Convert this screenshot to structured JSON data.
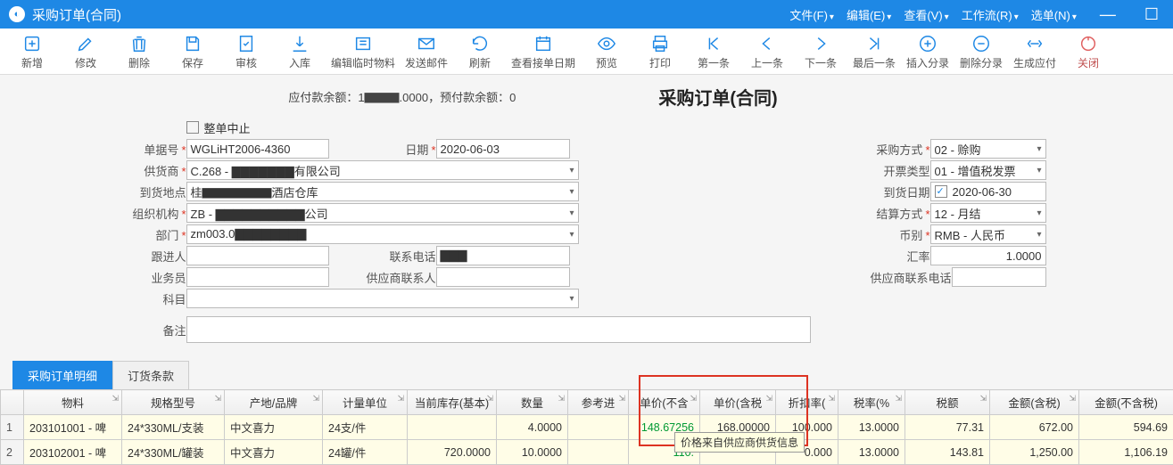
{
  "window": {
    "title": "采购订单(合同)"
  },
  "menus": [
    "文件(F)",
    "编辑(E)",
    "查看(V)",
    "工作流(R)",
    "选单(N)"
  ],
  "toolbar": [
    "新增",
    "修改",
    "删除",
    "保存",
    "审核",
    "入库",
    "编辑临时物料",
    "发送邮件",
    "刷新",
    "查看接单日期",
    "预览",
    "打印",
    "第一条",
    "上一条",
    "下一条",
    "最后一条",
    "插入分录",
    "删除分录",
    "生成应付",
    "关闭"
  ],
  "balances": "应付款余额：1▇▇▇.0000，预付款余额：0",
  "page_title": "采购订单(合同)",
  "form": {
    "suspend": "整单中止",
    "doc_no_lbl": "单据号",
    "doc_no": "WGLiHT2006-4360",
    "date_lbl": "日期",
    "date": "2020-06-03",
    "purch_mode_lbl": "采购方式",
    "purch_mode": "02 - 赊购",
    "vendor_lbl": "供货商",
    "vendor": "C.268 - ▇▇▇▇▇▇▇有限公司",
    "inv_type_lbl": "开票类型",
    "inv_type": "01 - 增值税发票",
    "recv_loc_lbl": "到货地点",
    "recv_loc": "桂▇▇▇▇▇▇酒店仓库",
    "recv_date_lbl": "到货日期",
    "recv_date": "2020-06-30",
    "org_lbl": "组织机构",
    "org": "ZB - ▇▇▇▇▇▇▇▇▇▇公司",
    "settle_lbl": "结算方式",
    "settle": "12 - 月结",
    "dept_lbl": "部门",
    "dept": "zm003.0▇▇▇▇▇▇▇▇",
    "curr_lbl": "币别",
    "curr": "RMB - 人民币",
    "follower_lbl": "跟进人",
    "follower": "",
    "phone_lbl": "联系电话",
    "phone": "▇▇▇",
    "rate_lbl": "汇率",
    "rate": "1.0000",
    "sales_lbl": "业务员",
    "sales": "",
    "v_contact_lbl": "供应商联系人",
    "v_contact": "",
    "v_phone_lbl": "供应商联系电话",
    "v_phone": "",
    "subject_lbl": "科目",
    "subject": "",
    "remark_lbl": "备注",
    "remark": ""
  },
  "tabs": [
    "采购订单明细",
    "订货条款"
  ],
  "grid": {
    "headers": [
      "",
      "物料",
      "规格型号",
      "产地/品牌",
      "计量单位",
      "当前库存(基本)",
      "数量",
      "参考进",
      "单价(不含",
      "单价(含税",
      "折扣率(",
      "税率(%",
      "税额",
      "金额(含税)",
      "金额(不含税)"
    ],
    "rows": [
      {
        "n": "1",
        "mat": "203101001 - 啤",
        "spec": "24*330ML/支装",
        "brand": "中文喜力",
        "uom": "24支/件",
        "stock": "",
        "qty": "4.0000",
        "ref": "",
        "pnotax": "148.67256",
        "ptax": "168.00000",
        "disc": "100.000",
        "rate": "13.0000",
        "tax": "77.31",
        "amt": "672.00",
        "amtnt": "594.69"
      },
      {
        "n": "2",
        "mat": "203102001 - 啤",
        "spec": "24*330ML/罐装",
        "brand": "中文喜力",
        "uom": "24罐/件",
        "stock": "720.0000",
        "qty": "10.0000",
        "ref": "",
        "pnotax": "110.",
        "ptax": "",
        "disc": "0.000",
        "rate": "13.0000",
        "tax": "143.81",
        "amt": "1,250.00",
        "amtnt": "1,106.19"
      }
    ]
  },
  "tooltip": "价格来自供应商供货信息"
}
